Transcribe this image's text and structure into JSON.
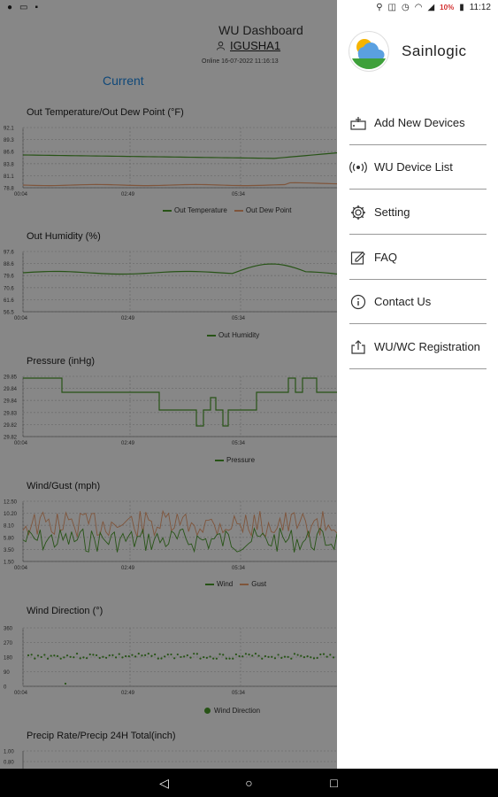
{
  "statusbar": {
    "battery": "10%",
    "time": "11:12"
  },
  "header": {
    "title": "WU Dashboard",
    "user": "IGUSHA1",
    "online": "Online 16-07-2022 11:16:13",
    "tab": "Current"
  },
  "charts": {
    "temp": {
      "title": "Out Temperature/Out Dew Point (°F)",
      "yticks": [
        "92.1",
        "89.3",
        "86.6",
        "83.8",
        "81.1",
        "78.8"
      ],
      "xticks": [
        "00:04",
        "02:49",
        "05:34"
      ],
      "legend": [
        "Out Temperature",
        "Out Dew Point"
      ]
    },
    "humidity": {
      "title": "Out Humidity (%)",
      "yticks": [
        "97.6",
        "88.6",
        "79.6",
        "70.6",
        "61.6",
        "56.5"
      ],
      "xticks": [
        "00:04",
        "02:49",
        "05:34"
      ],
      "legend": [
        "Out Humidity"
      ]
    },
    "pressure": {
      "title": "Pressure (inHg)",
      "yticks": [
        "29.85",
        "29.84",
        "29.84",
        "29.83",
        "29.82",
        "29.82"
      ],
      "xticks": [
        "00:04",
        "02:49",
        "05:34"
      ],
      "legend": [
        "Pressure"
      ]
    },
    "wind": {
      "title": "Wind/Gust (mph)",
      "yticks": [
        "12.50",
        "10.20",
        "8.10",
        "5.80",
        "3.50",
        "1.50"
      ],
      "xticks": [
        "00:04",
        "02:49",
        "05:34"
      ],
      "legend": [
        "Wind",
        "Gust"
      ]
    },
    "direction": {
      "title": "Wind Direction (°)",
      "yticks": [
        "360",
        "270",
        "180",
        "90",
        "0"
      ],
      "xticks": [
        "00:04",
        "02:49",
        "05:34"
      ],
      "legend": [
        "Wind Direction"
      ]
    },
    "precip": {
      "title": "Precip Rate/Precip 24H Total(inch)",
      "yticks": [
        "1.00",
        "0.80"
      ]
    }
  },
  "colors": {
    "green": "#4a9d2a",
    "orange": "#f0a070",
    "accent": "#1e88e5"
  },
  "drawer": {
    "brand": "Sainlogic",
    "logo_text": "Sainlogic",
    "items": [
      {
        "label": "Add New Devices",
        "icon": "add-device-icon"
      },
      {
        "label": "WU Device List",
        "icon": "wifi-broadcast-icon"
      },
      {
        "label": "Setting",
        "icon": "gear-icon"
      },
      {
        "label": "FAQ",
        "icon": "edit-note-icon"
      },
      {
        "label": "Contact Us",
        "icon": "info-icon"
      },
      {
        "label": "WU/WC Registration",
        "icon": "upload-icon"
      }
    ]
  }
}
